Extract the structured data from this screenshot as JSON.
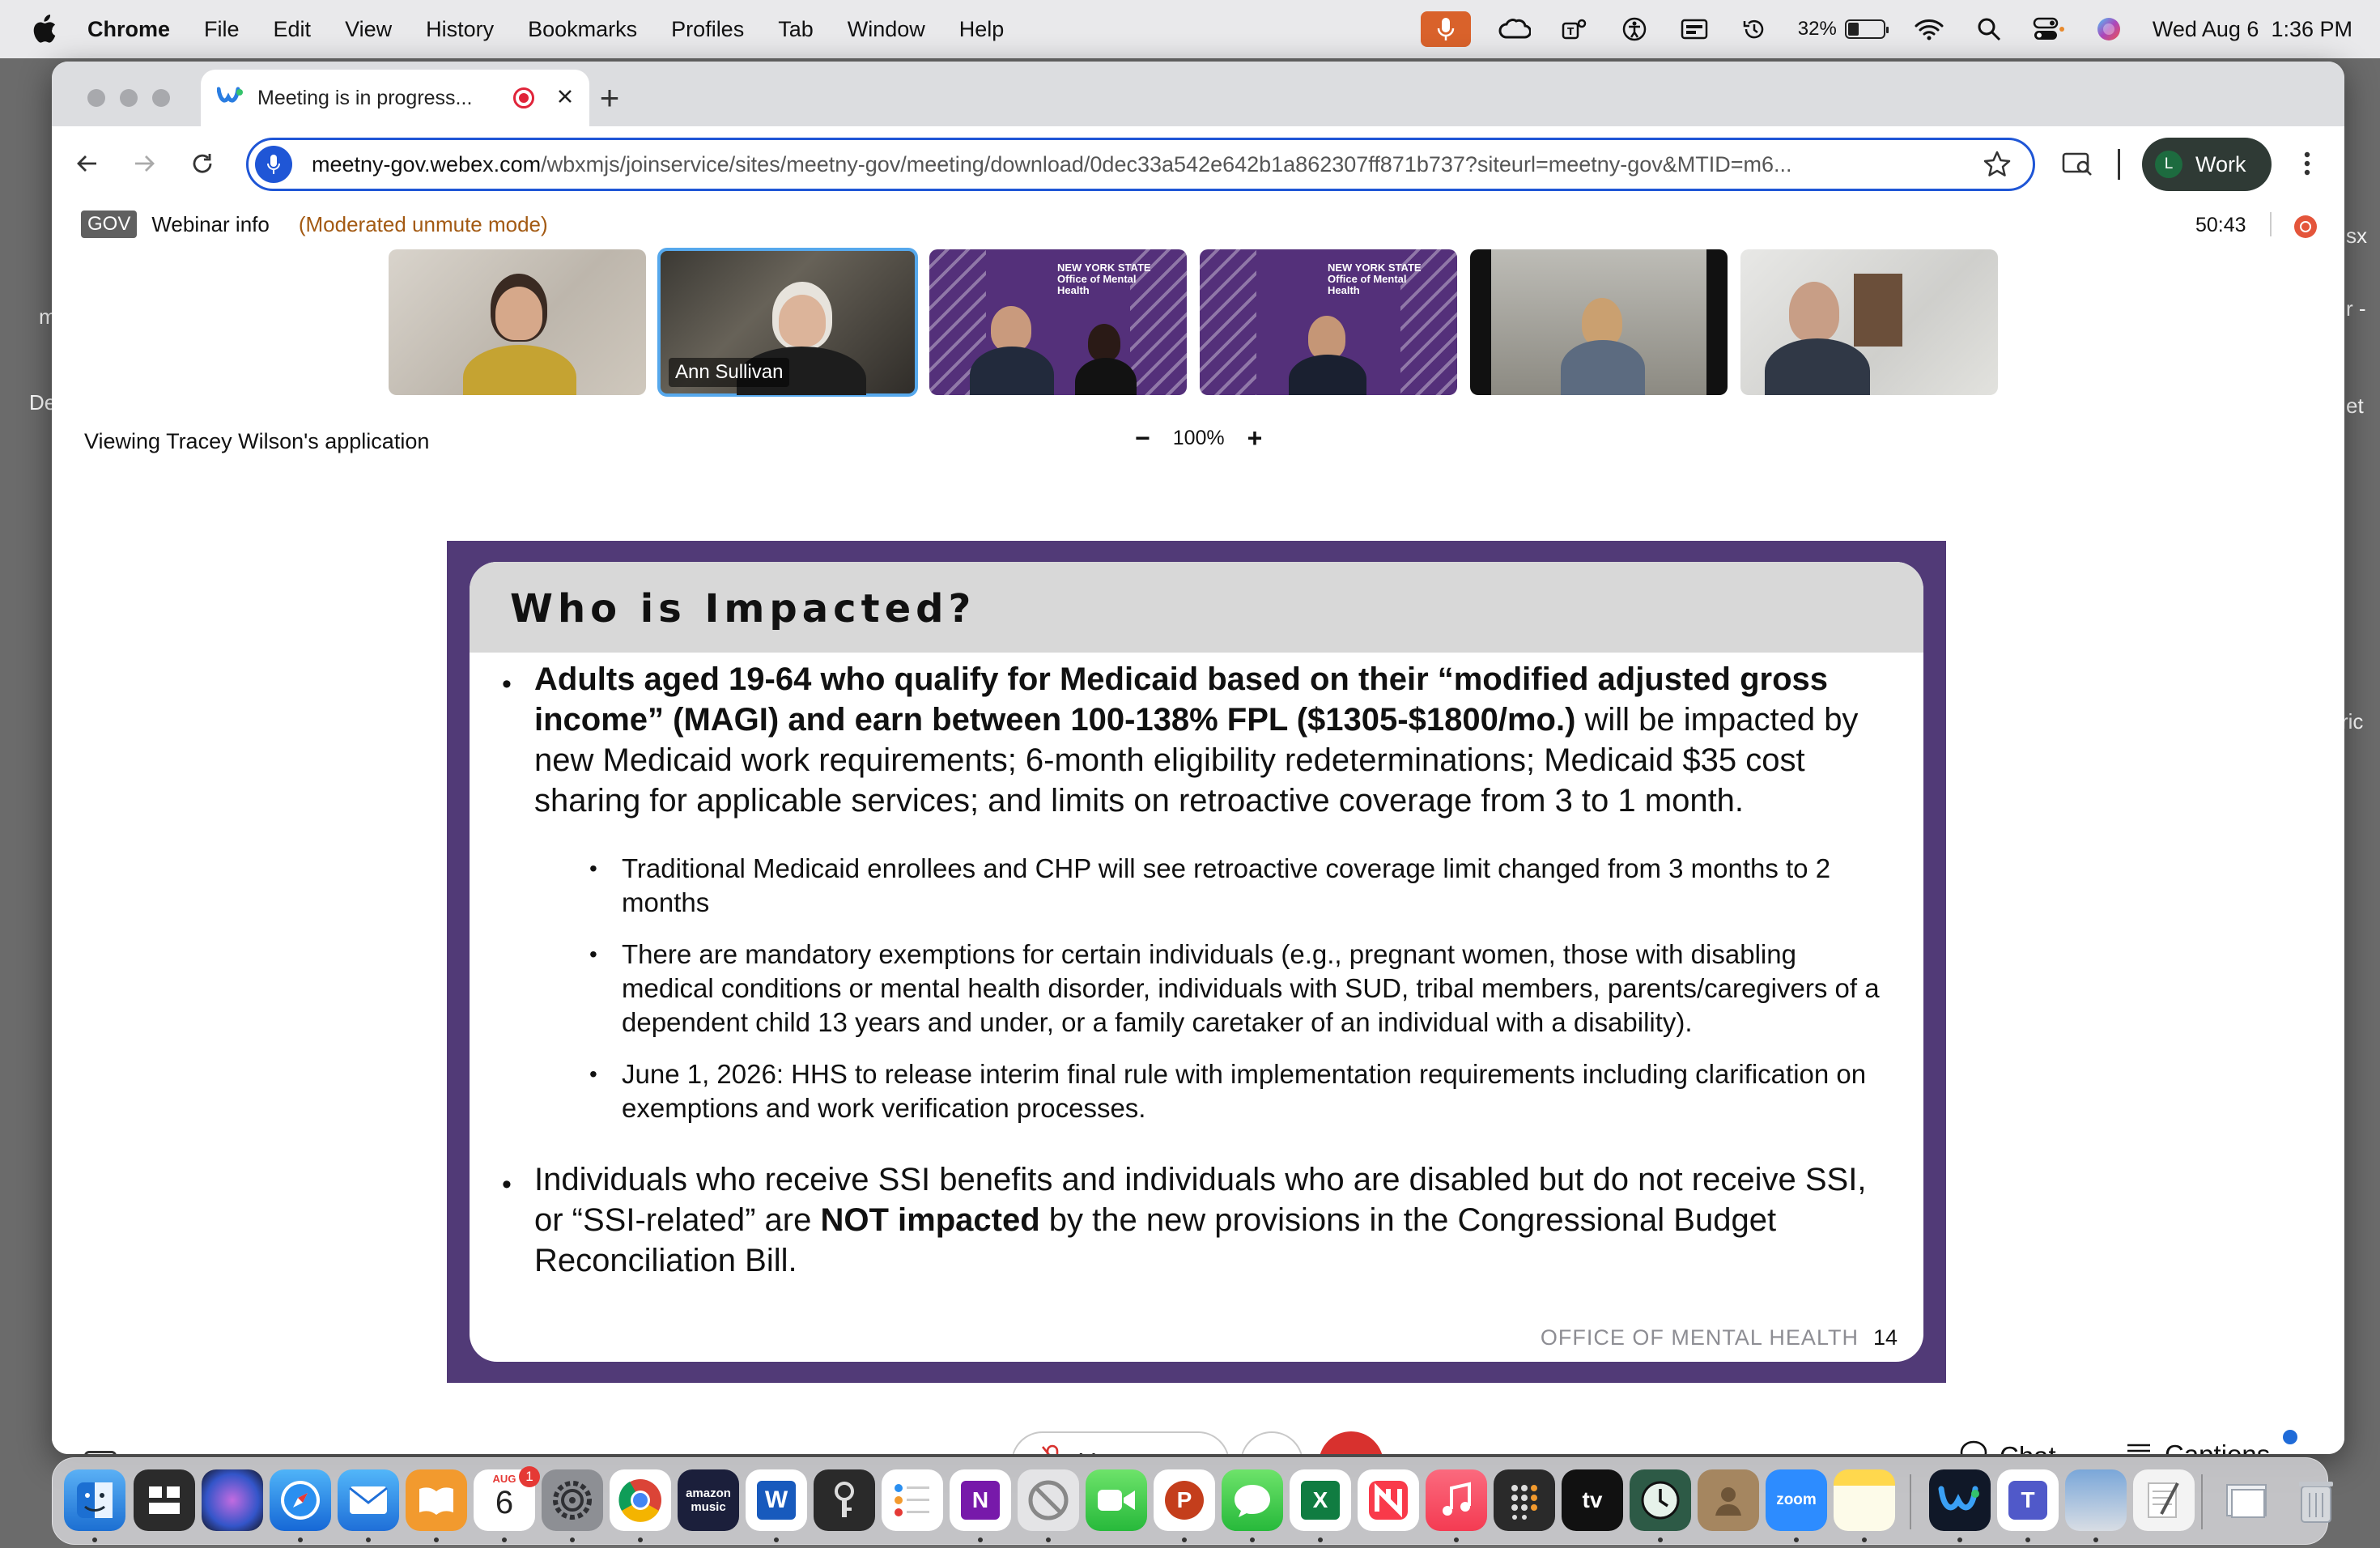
{
  "menubar": {
    "app_name": "Chrome",
    "items": [
      "File",
      "Edit",
      "View",
      "History",
      "Bookmarks",
      "Profiles",
      "Tab",
      "Window",
      "Help"
    ],
    "battery_percent": "32%",
    "battery_level": 0.32,
    "datetime": "Wed Aug 6  1:36 PM"
  },
  "desktop": {
    "left_fragments": [
      "m",
      "De"
    ],
    "right_fragments": [
      "sx",
      "r -",
      "et",
      "ric"
    ]
  },
  "browser": {
    "tab_title": "Meeting is in progress...",
    "new_tab_symbol": "+",
    "url_host": "meetny-gov.webex.com",
    "url_path": "/wbxmjs/joinservice/sites/meetny-gov/meeting/download/0dec33a542e642b1a862307ff871b737?siteurl=meetny-gov&MTID=m6...",
    "profile_initial": "L",
    "profile_name": "Work"
  },
  "webex": {
    "gov_badge": "GOV",
    "webinar_info": "Webinar info",
    "mode": "(Moderated unmute mode)",
    "timer": "50:43",
    "active_speaker": "Ann Sullivan",
    "viewing_label": "Viewing Tracey Wilson's application",
    "zoom_minus": "−",
    "zoom_level": "100%",
    "zoom_plus": "+",
    "tile_logo_text": "NEW YORK STATE  Office of Mental Health"
  },
  "slide": {
    "title": "Who is Impacted?",
    "bullet1_bold": "Adults aged 19-64 who qualify for Medicaid based on their “modified adjusted gross income” (MAGI) and earn between 100-138% FPL ($1305-$1800/mo.)",
    "bullet1_rest": " will be impacted by new Medicaid work requirements; 6-month eligibility redeterminations; Medicaid $35 cost sharing for applicable services; and limits on retroactive coverage from 3 to 1 month.",
    "sub1": "Traditional Medicaid enrollees and CHP will see retroactive coverage limit changed from 3 months to 2 months",
    "sub2": "There are mandatory exemptions for certain individuals (e.g., pregnant women, those with disabling medical conditions or mental health disorder, individuals with SUD, tribal members, parents/caregivers of a dependent child 13 years and under, or a family caretaker of an individual with a disability).",
    "sub3": "June 1, 2026: HHS to release interim final rule with implementation requirements including clarification on exemptions and work verification processes.",
    "bullet2_a": "Individuals who receive SSI benefits and individuals who are disabled but do not receive SSI, or “SSI-related” are ",
    "bullet2_bold": "NOT impacted",
    "bullet2_b": " by the new provisions in the Congressional Budget Reconciliation Bill.",
    "footer_org": "OFFICE OF MENTAL HEALTH",
    "page_number": "14"
  },
  "controls": {
    "cc_label": "CC",
    "unmute_label": "Unmute",
    "more_label": "···",
    "chat_label": "Chat",
    "captions_label": "Captions"
  },
  "dock": {
    "calendar_month": "AUG",
    "calendar_day": "6",
    "calendar_badge": "1",
    "amazon_label": "amazon music",
    "word_label": "W",
    "onenote_label": "N",
    "powerpoint_label": "P",
    "excel_label": "X",
    "tv_label": "tv",
    "zoom_label": "zoom",
    "teams_label": "T"
  },
  "colors": {
    "slide_frame": "#513a77",
    "omnibox_accent": "#1f56d6",
    "leave_button": "#d8312e",
    "mode_text": "#a35a13"
  }
}
